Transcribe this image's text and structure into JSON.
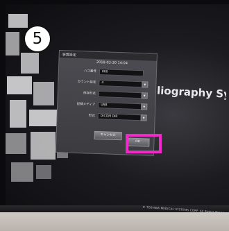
{
  "step_marker": "5",
  "brand_text": "liography Sys",
  "copyright": "© TOSHIBA MEDICAL SYSTEMS CORP. All Rights Reserved",
  "dialog": {
    "title": "装置設定",
    "datetime": "2018-03-30 14:04",
    "fields": [
      {
        "label": "ハコ番号",
        "value": "000",
        "has_dropdown": false
      },
      {
        "label": "カウント設定",
        "value": "4",
        "has_dropdown": true
      },
      {
        "label": "保存形式",
        "value": "",
        "has_dropdown": true
      },
      {
        "label": "記録メディア",
        "value": "USB",
        "has_dropdown": true
      },
      {
        "label": "形式",
        "value": "DICOM DIR",
        "has_dropdown": true
      }
    ],
    "cancel_label": "キャンセル",
    "ok_label": "OK"
  },
  "colors": {
    "highlight": "#ee2bc8",
    "dialog_bg": "#44444a"
  }
}
